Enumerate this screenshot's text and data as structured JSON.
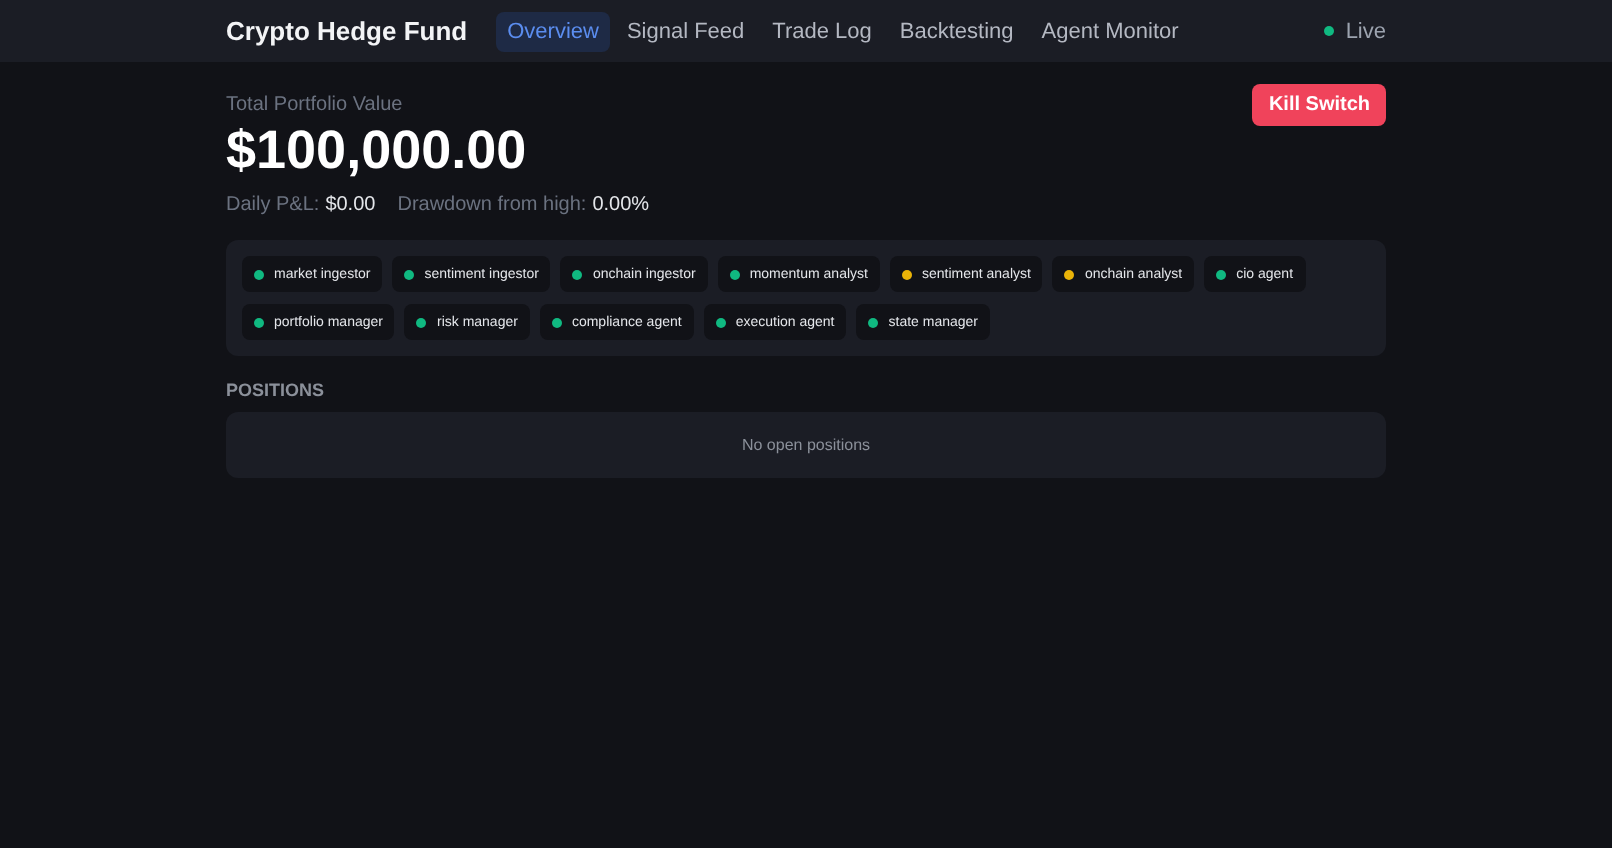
{
  "brand": "Crypto Hedge Fund",
  "tabs": [
    {
      "label": "Overview",
      "selected": true
    },
    {
      "label": "Signal Feed",
      "selected": false
    },
    {
      "label": "Trade Log",
      "selected": false
    },
    {
      "label": "Backtesting",
      "selected": false
    },
    {
      "label": "Agent Monitor",
      "selected": false
    }
  ],
  "status": {
    "label": "Live",
    "color": "#10b981"
  },
  "portfolio": {
    "label": "Total Portfolio Value",
    "value": "$100,000.00",
    "daily_pnl_label": "Daily P&L:",
    "daily_pnl": "$0.00",
    "drawdown_label": "Drawdown from high:",
    "drawdown": "0.00%"
  },
  "kill_switch": "Kill Switch",
  "agents": [
    {
      "name": "market ingestor",
      "color": "#10b981"
    },
    {
      "name": "sentiment ingestor",
      "color": "#10b981"
    },
    {
      "name": "onchain ingestor",
      "color": "#10b981"
    },
    {
      "name": "momentum analyst",
      "color": "#10b981"
    },
    {
      "name": "sentiment analyst",
      "color": "#eab308"
    },
    {
      "name": "onchain analyst",
      "color": "#eab308"
    },
    {
      "name": "cio agent",
      "color": "#10b981"
    },
    {
      "name": "portfolio manager",
      "color": "#10b981"
    },
    {
      "name": "risk manager",
      "color": "#10b981"
    },
    {
      "name": "compliance agent",
      "color": "#10b981"
    },
    {
      "name": "execution agent",
      "color": "#10b981"
    },
    {
      "name": "state manager",
      "color": "#10b981"
    }
  ],
  "positions": {
    "title": "POSITIONS",
    "empty": "No open positions"
  }
}
